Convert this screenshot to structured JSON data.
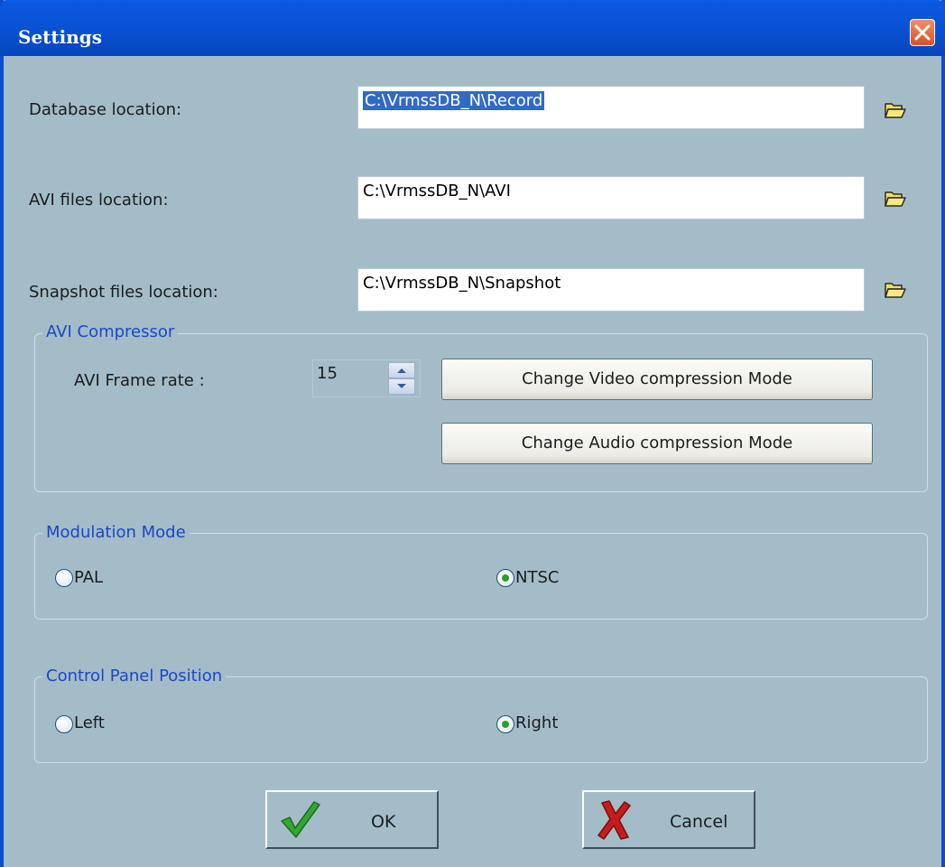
{
  "window": {
    "title": "Settings"
  },
  "paths": {
    "database": {
      "label": "Database location:",
      "value": "C:\\VrmssDB_N\\Record"
    },
    "avi": {
      "label": "AVI files location:",
      "value": "C:\\VrmssDB_N\\AVI"
    },
    "snapshot": {
      "label": "Snapshot files location:",
      "value": "C:\\VrmssDB_N\\Snapshot"
    }
  },
  "avi_compressor": {
    "title": "AVI Compressor",
    "frame_rate_label": "AVI Frame rate :",
    "frame_rate_value": "15",
    "video_button": "Change Video compression Mode",
    "audio_button": "Change Audio compression Mode"
  },
  "modulation": {
    "title": "Modulation Mode",
    "options": [
      {
        "label": "PAL",
        "selected": false
      },
      {
        "label": "NTSC",
        "selected": true
      }
    ]
  },
  "control_panel": {
    "title": "Control Panel Position",
    "options": [
      {
        "label": "Left",
        "selected": false
      },
      {
        "label": "Right",
        "selected": true
      }
    ]
  },
  "buttons": {
    "ok": "OK",
    "cancel": "Cancel"
  },
  "icons": {
    "close": "close-icon",
    "browse": "folder-open-icon",
    "ok": "checkmark-icon",
    "cancel": "x-mark-icon"
  },
  "colors": {
    "titlebar": "#0a50d0",
    "dialog_bg": "#a3bcc8",
    "group_title": "#1a48c8",
    "selection": "#316ac5",
    "radio_dot": "#26a326"
  }
}
